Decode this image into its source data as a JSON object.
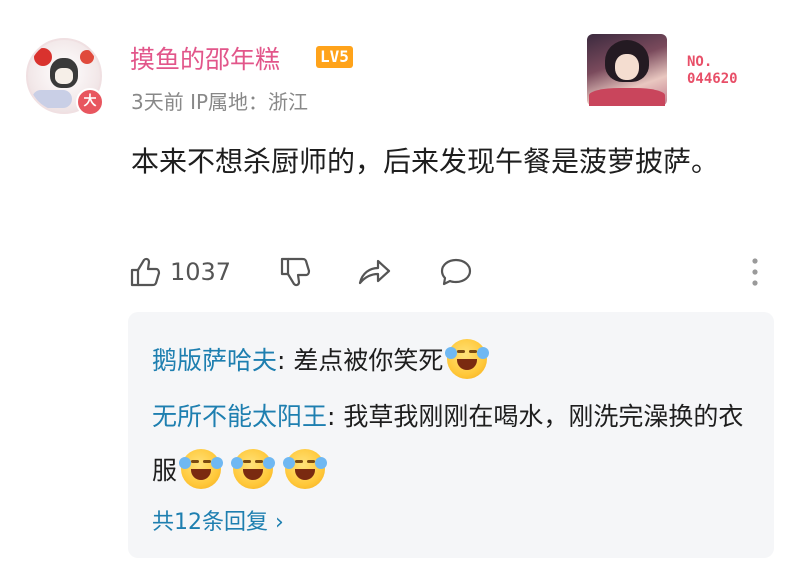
{
  "comment": {
    "username": "摸鱼的邵年糕",
    "level": "LV5",
    "avatar_badge": "大",
    "meta": "3天前  IP属地：浙江",
    "card_number_prefix": "NO.",
    "card_number": "044620",
    "text": "本来不想杀厨师的，后来发现午餐是菠萝披萨。",
    "like_count": "1037",
    "icons": [
      "like-icon",
      "dislike-icon",
      "share-icon",
      "reply-icon",
      "more-icon"
    ]
  },
  "replies": {
    "items": [
      {
        "name": "鹅版萨哈夫",
        "sep": ": ",
        "text": "差点被你笑死",
        "emoji_count": 1
      },
      {
        "name": "无所不能太阳王",
        "sep": ": ",
        "text": "我草我刚刚在喝水，刚洗完澡换的衣服",
        "emoji_count": 3
      }
    ],
    "more_label": "共12条回复 ›"
  },
  "colors": {
    "username": "#e2568a",
    "level_badge": "#ffa31a",
    "reply_name": "#1e7fb0",
    "reply_bg": "#f5f6f8",
    "card_number": "#e84f68"
  }
}
